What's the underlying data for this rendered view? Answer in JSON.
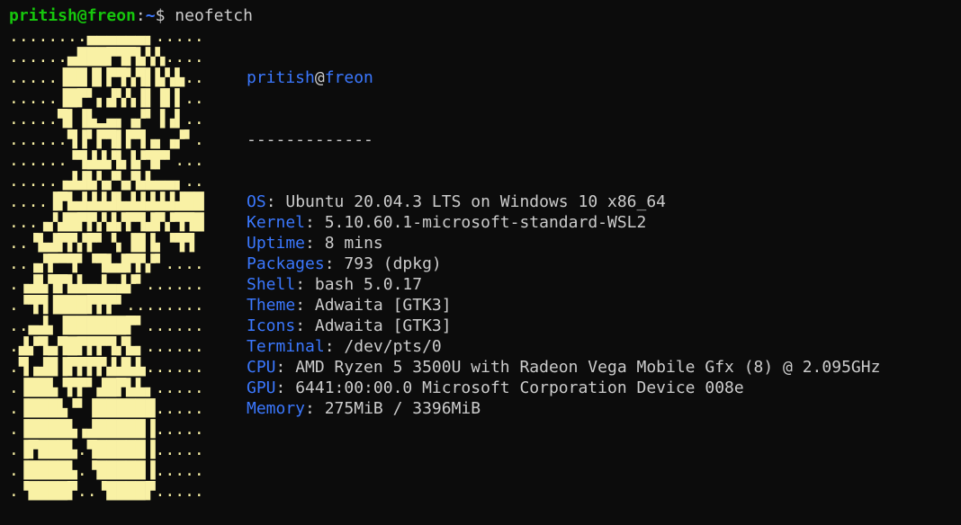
{
  "prompt": {
    "user_host": "pritish@freon",
    "colon": ":",
    "path": "~",
    "symbol": "$",
    "command": "neofetch"
  },
  "colors": {
    "background": "#0c0c0c",
    "text": "#cccccc",
    "prompt_user": "#16c60c",
    "accent_blue": "#3b78ff",
    "ascii_yellow": "#f9f1a5"
  },
  "ascii_logo": [
    "........▄▄▄▄▄▄▖.....",
    "......▄███▛▜▛▙▚▚....",
    ".....▐██▐▌▛▜▚▜▌▙▚▙..",
    ".....▐█▛▘▖▟▚▚▐▌▐▌▌..",
    ".....▜▌▐▙▂▄▖▗▞▘▐▗▌..",
    "......▜▐▘▛▜▌▛▜▗▖▗▞▘.",
    "......▝▜▟▟▞▙▐▞▜▛▘...",
    ".....▗▟▟▙▚▞▚▞▙▙▄▄▖..",
    "....▐▛▙▟▟▟▟▙▟▟▟▟▟▟██",
    "...▗▞▟█▛▛▞▟▞▛▜▟▛▞▜▜█",
    "..▝▙▟▛▛▞▛▘▝▖▐█▐▖▝▜▜",
    "..▗▞▛▀▜▘▝▜▙▟▛▛▞▘....",
    ".▗▟▙▜▛▙▙▄▟▄▟▞▘......",
    ".▝▜▜▐███▛▛▛▘........",
    "..▄▟▖▐██████▛▘......",
    ".▟▞▜▄▜█▛▛▛▜▞▙▖......",
    ".▜▗▟█▐▛▛▛▛▟▟▙▙......",
    ".▐██▙▝▛▛▘▟█▛▙▙▖.....",
    ".▐███▙▝▘▐██████.....",
    ".▐████▙▗▟█████▐.....",
    ".▐▛███▙.▜█████▐.....",
    ".▐████▙.▝█████▐.....",
    ".▝████▛..▝████▛....."
  ],
  "info": {
    "user": "pritish",
    "at": "@",
    "host": "freon",
    "separator": "-------------",
    "rows": [
      {
        "key": "OS",
        "value": "Ubuntu 20.04.3 LTS on Windows 10 x86_64"
      },
      {
        "key": "Kernel",
        "value": "5.10.60.1-microsoft-standard-WSL2"
      },
      {
        "key": "Uptime",
        "value": "8 mins"
      },
      {
        "key": "Packages",
        "value": "793 (dpkg)"
      },
      {
        "key": "Shell",
        "value": "bash 5.0.17"
      },
      {
        "key": "Theme",
        "value": "Adwaita [GTK3]"
      },
      {
        "key": "Icons",
        "value": "Adwaita [GTK3]"
      },
      {
        "key": "Terminal",
        "value": "/dev/pts/0"
      },
      {
        "key": "CPU",
        "value": "AMD Ryzen 5 3500U with Radeon Vega Mobile Gfx (8) @ 2.095GHz"
      },
      {
        "key": "GPU",
        "value": "6441:00:00.0 Microsoft Corporation Device 008e"
      },
      {
        "key": "Memory",
        "value": "275MiB / 3396MiB"
      }
    ],
    "key_separator": ": "
  }
}
